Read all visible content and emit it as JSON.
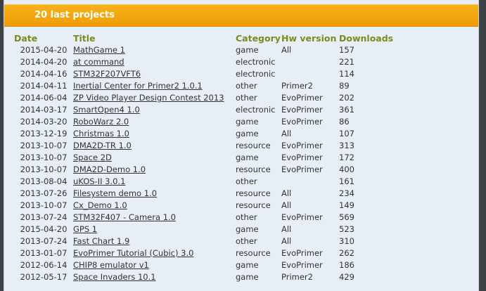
{
  "panel": {
    "title": "20 last projects"
  },
  "table": {
    "headers": {
      "date": "Date",
      "title": "Title",
      "category": "Category",
      "hw": "Hw version",
      "downloads": "Downloads"
    },
    "rows": [
      {
        "date": "2015-04-20",
        "title": "MathGame 1",
        "category": "game",
        "hw": "All",
        "downloads": "157"
      },
      {
        "date": "2014-04-20",
        "title": "at command",
        "category": "electronic",
        "hw": "",
        "downloads": "221"
      },
      {
        "date": "2014-04-16",
        "title": "STM32F207VFT6",
        "category": "electronic",
        "hw": "",
        "downloads": "114"
      },
      {
        "date": "2014-04-11",
        "title": "Inertial Center for Primer2 1.0.1",
        "category": "other",
        "hw": "Primer2",
        "downloads": "89"
      },
      {
        "date": "2014-06-04",
        "title": "ZP Video Player Design Contest 2013",
        "category": "other",
        "hw": "EvoPrimer",
        "downloads": "202"
      },
      {
        "date": "2014-03-17",
        "title": "SmartOpen4 1.0",
        "category": "electronic",
        "hw": "EvoPrimer",
        "downloads": "361"
      },
      {
        "date": "2014-03-20",
        "title": "RoboWarz 2.0",
        "category": "game",
        "hw": "EvoPrimer",
        "downloads": "86"
      },
      {
        "date": "2013-12-19",
        "title": "Christmas 1.0",
        "category": "game",
        "hw": "All",
        "downloads": "107"
      },
      {
        "date": "2013-10-07",
        "title": "DMA2D-TR 1.0",
        "category": "resource",
        "hw": "EvoPrimer",
        "downloads": "313"
      },
      {
        "date": "2013-10-07",
        "title": "Space 2D",
        "category": "game",
        "hw": "EvoPrimer",
        "downloads": "172"
      },
      {
        "date": "2013-10-07",
        "title": "DMA2D-Demo 1.0",
        "category": "resource",
        "hw": "EvoPrimer",
        "downloads": "400"
      },
      {
        "date": "2013-08-04",
        "title": "uKOS-II 3.0.1",
        "category": "other",
        "hw": "",
        "downloads": "161"
      },
      {
        "date": "2013-07-26",
        "title": "Filesystem demo 1.0",
        "category": "resource",
        "hw": "All",
        "downloads": "234"
      },
      {
        "date": "2013-10-07",
        "title": "Cx_Demo 1.0",
        "category": "resource",
        "hw": "All",
        "downloads": "149"
      },
      {
        "date": "2013-07-24",
        "title": "STM32F407 - Camera 1.0",
        "category": "other",
        "hw": "EvoPrimer",
        "downloads": "569"
      },
      {
        "date": "2015-04-20",
        "title": "GPS 1",
        "category": "game",
        "hw": "All",
        "downloads": "523"
      },
      {
        "date": "2013-07-24",
        "title": "Fast Chart 1.9",
        "category": "other",
        "hw": "All",
        "downloads": "310"
      },
      {
        "date": "2013-01-07",
        "title": "EvoPrimer Tutorial (Cubic) 3.0",
        "category": "resource",
        "hw": "EvoPrimer",
        "downloads": "262"
      },
      {
        "date": "2012-06-14",
        "title": "CHIP8 emulator v1",
        "category": "game",
        "hw": "EvoPrimer",
        "downloads": "186"
      },
      {
        "date": "2012-05-17",
        "title": "Space Invaders 10.1",
        "category": "game",
        "hw": "Primer2",
        "downloads": "429"
      }
    ]
  }
}
